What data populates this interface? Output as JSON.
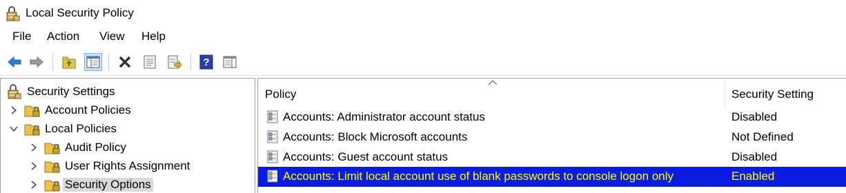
{
  "window": {
    "title": "Local Security Policy",
    "app_icon": "security-policy-icon"
  },
  "menu": [
    "File",
    "Action",
    "View",
    "Help"
  ],
  "toolbar": {
    "buttons": [
      "back-arrow-icon",
      "forward-arrow-icon",
      "up-folder-icon",
      "show-hide-tree-icon",
      "delete-icon",
      "properties-icon",
      "export-list-icon",
      "help-icon",
      "show-hide-action-pane-icon"
    ]
  },
  "tree": {
    "items": [
      {
        "label": "Security Settings",
        "icon": "security-settings-icon"
      },
      {
        "label": "Account Policies",
        "icon": "folder-lock-icon",
        "state": "collapsed"
      },
      {
        "label": "Local Policies",
        "icon": "folder-lock-icon",
        "state": "expanded"
      },
      {
        "label": "Audit Policy",
        "icon": "folder-lock-icon",
        "state": "collapsed"
      },
      {
        "label": "User Rights Assignment",
        "icon": "folder-lock-icon",
        "state": "collapsed"
      },
      {
        "label": "Security Options",
        "icon": "folder-lock-icon",
        "state": "collapsed",
        "selected": true
      }
    ]
  },
  "list": {
    "columns": [
      "Policy",
      "Security Setting"
    ],
    "rows": [
      {
        "policy": "Accounts: Administrator account status",
        "setting": "Disabled"
      },
      {
        "policy": "Accounts: Block Microsoft accounts",
        "setting": "Not Defined"
      },
      {
        "policy": "Accounts: Guest account status",
        "setting": "Disabled"
      },
      {
        "policy": "Accounts: Limit local account use of blank passwords to console logon only",
        "setting": "Enabled",
        "selected": true
      }
    ]
  },
  "colors": {
    "selection": "#0a1de0",
    "selection_text": "#ffff00",
    "tree_selection": "#d9d9d9"
  }
}
